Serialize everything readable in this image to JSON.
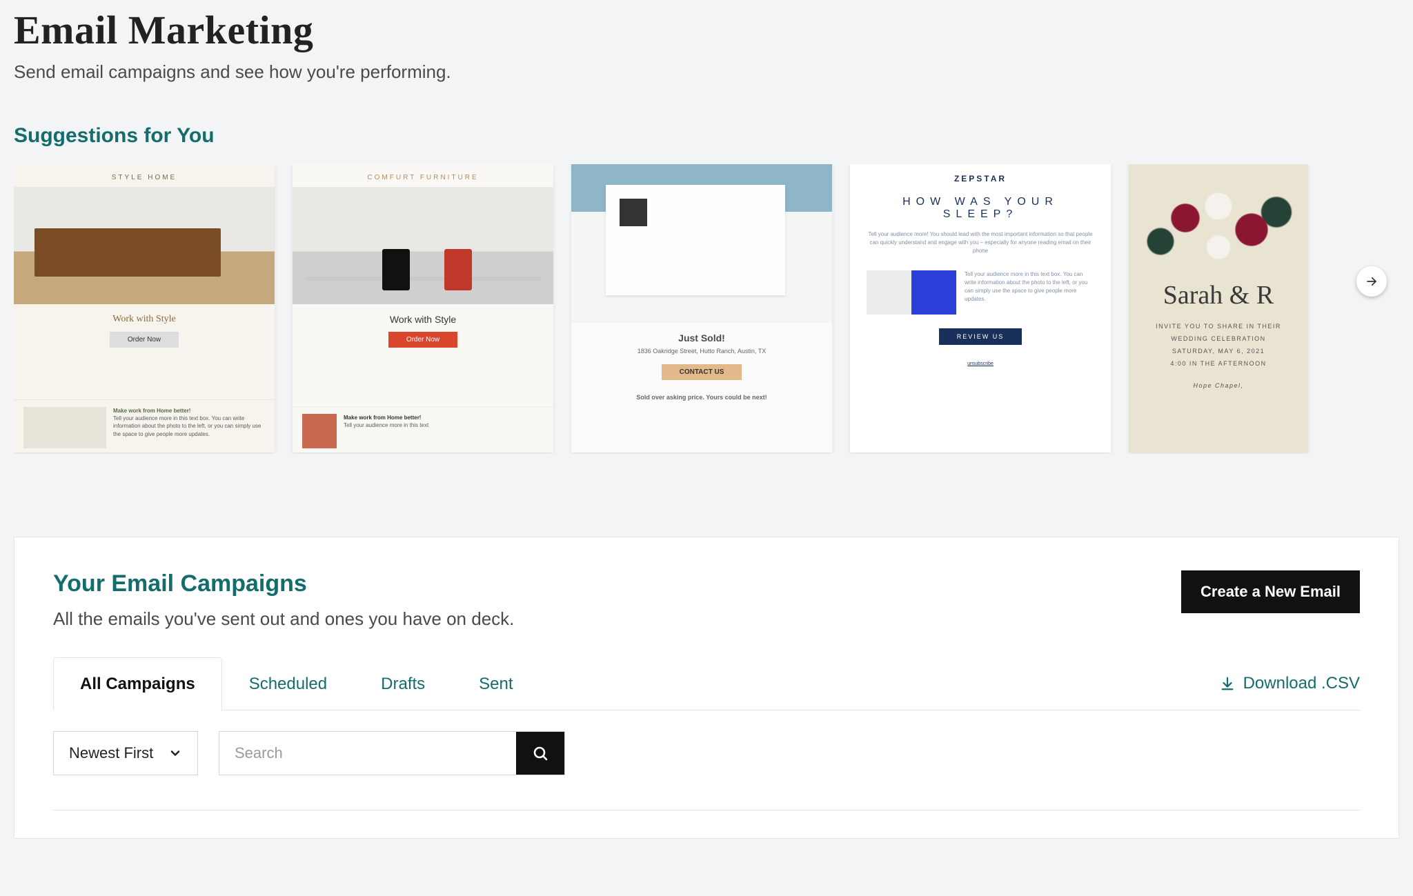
{
  "header": {
    "title": "Email Marketing",
    "subtitle": "Send email campaigns and see how you're performing."
  },
  "suggestions": {
    "heading": "Suggestions for You",
    "cards": [
      {
        "brand": "STYLE HOME",
        "headline": "Work with Style",
        "cta": "Order Now",
        "lower_title": "Make work from Home better!",
        "lower_body": "Tell your audience more in this text box. You can write information about the photo to the left, or you can simply use the space to give people more updates."
      },
      {
        "brand": "COMFURT FURNITURE",
        "headline": "Work with Style",
        "cta": "Order Now",
        "lower_title": "Make work from Home better!",
        "lower_body": "Tell your audience more in this text"
      },
      {
        "headline": "Just Sold!",
        "subline": "1836 Oakridge Street, Hutto Ranch, Austin, TX",
        "cta": "CONTACT US",
        "footline": "Sold over asking price. Yours could be next!"
      },
      {
        "brand": "ZEPSTAR",
        "question": "HOW WAS YOUR SLEEP?",
        "subline": "Tell your audience more! You should lead with the most important information so that people can quickly understand and engage with you – especially for anyone reading email on their phone",
        "row_text": "Tell your audience more in this text box. You can write information about the photo to the left, or you can simply use the space to give people more updates.",
        "cta": "REVIEW US",
        "footer": "unsubscribe"
      },
      {
        "names": "Sarah & R",
        "line1": "INVITE YOU TO SHARE IN THEIR",
        "line2": "WEDDING CELEBRATION",
        "line3": "SATURDAY, MAY 6, 2021",
        "line4": "4:00 IN THE AFTERNOON",
        "line5": "Hope Chapel,"
      }
    ]
  },
  "campaigns": {
    "title": "Your Email Campaigns",
    "subtitle": "All the emails you've sent out and ones you have on deck.",
    "new_email_label": "Create a New Email",
    "tabs": [
      {
        "label": "All Campaigns",
        "active": true
      },
      {
        "label": "Scheduled",
        "active": false
      },
      {
        "label": "Drafts",
        "active": false
      },
      {
        "label": "Sent",
        "active": false
      }
    ],
    "download_label": "Download .CSV",
    "sort_label": "Newest First",
    "search_placeholder": "Search"
  }
}
